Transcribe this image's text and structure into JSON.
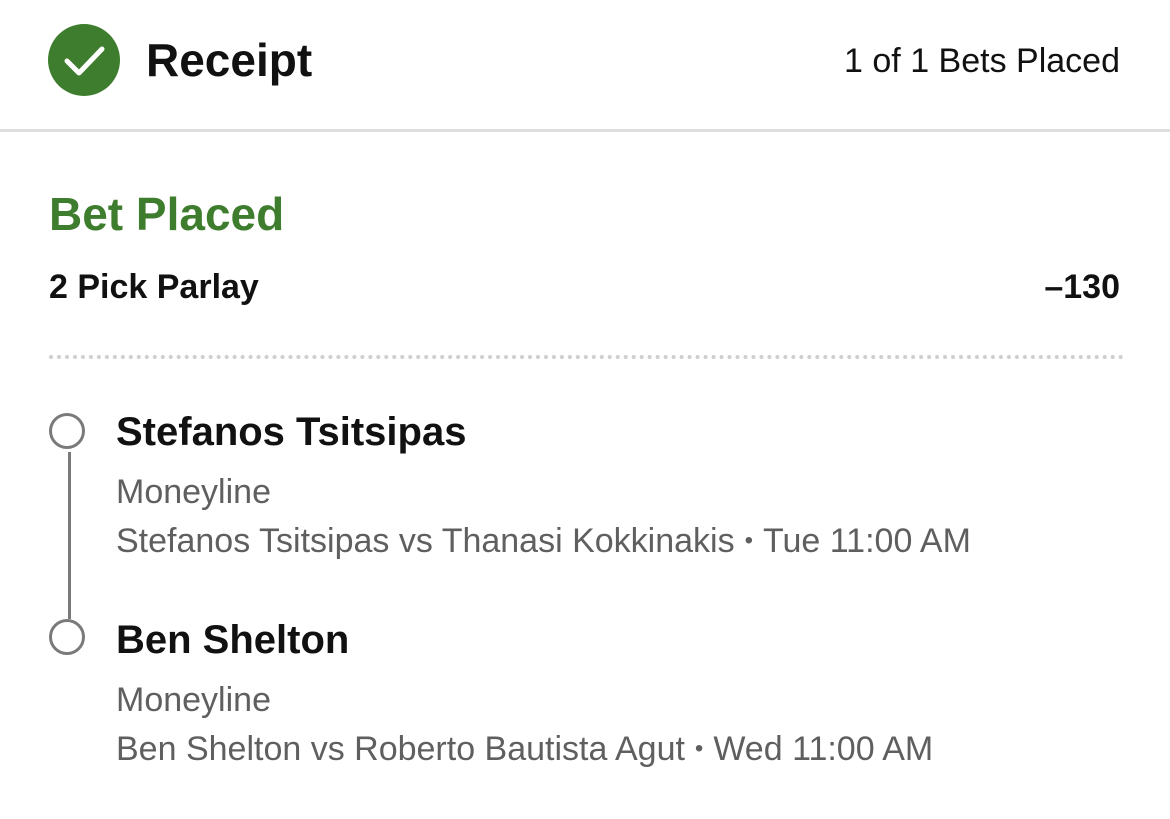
{
  "header": {
    "title": "Receipt",
    "bets_placed": "1 of 1 Bets Placed",
    "check_icon": "checkmark-circle-icon",
    "accent_color": "#3f7d2e"
  },
  "bet": {
    "status": "Bet Placed",
    "type": "2 Pick Parlay",
    "odds": "–130"
  },
  "legs": [
    {
      "selection": "Stefanos Tsitsipas",
      "market": "Moneyline",
      "matchup": "Stefanos Tsitsipas vs Thanasi Kokkinakis",
      "separator": "•",
      "time": "Tue 11:00 AM"
    },
    {
      "selection": "Ben Shelton",
      "market": "Moneyline",
      "matchup": "Ben Shelton vs Roberto Bautista Agut",
      "separator": "•",
      "time": "Wed 11:00 AM"
    }
  ]
}
